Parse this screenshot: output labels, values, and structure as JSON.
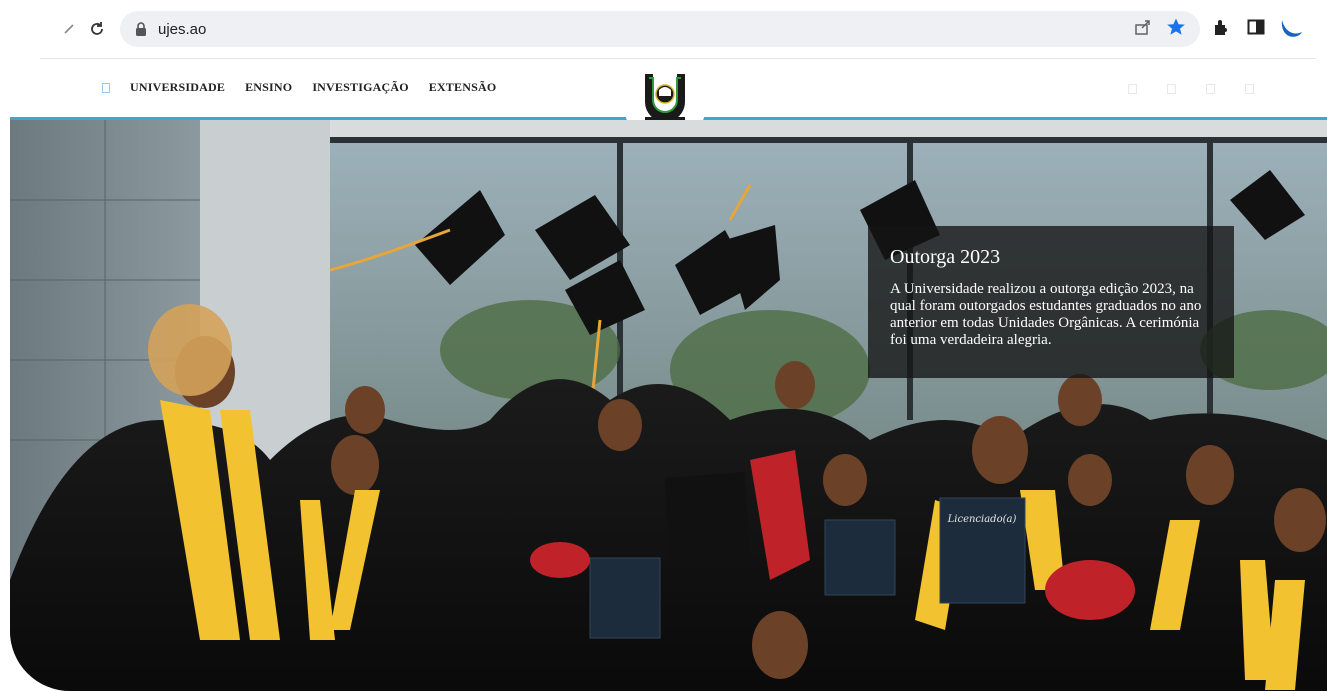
{
  "browser": {
    "url": "ujes.ao"
  },
  "nav": {
    "items": [
      {
        "label": "UNIVERSIDADE"
      },
      {
        "label": "ENSINO"
      },
      {
        "label": "INVESTIGAÇÃO"
      },
      {
        "label": "EXTENSÃO"
      }
    ]
  },
  "logo": {
    "text": "UJES"
  },
  "hero": {
    "caption_title": "Outorga 2023",
    "caption_text": "A Universidade realizou a outorga edição 2023, na qual foram outorgados estudantes graduados no ano anterior em todas Unidades Orgânicas. A cerimónia foi uma verdadeira alegria.",
    "diploma_label": "Licenciado(a)"
  },
  "colors": {
    "accent_line": "#3fa4d8",
    "bookmark_star": "#1a73e8",
    "stole_yellow": "#f2c230",
    "gown_black": "#121212"
  },
  "icons": [
    "back-icon",
    "reload-icon",
    "lock-icon",
    "share-icon",
    "bookmark-star-icon",
    "extensions-icon",
    "side-panel-icon",
    "profile-icon",
    "home-icon"
  ]
}
